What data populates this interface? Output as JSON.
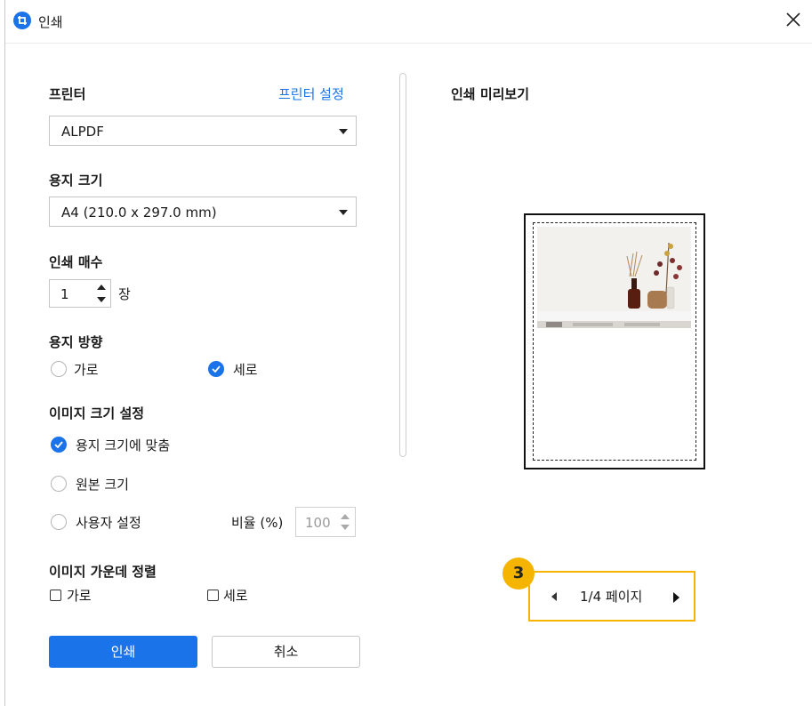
{
  "window": {
    "title": "인쇄",
    "close_icon": "close-icon"
  },
  "printer": {
    "label": "프린터",
    "settings_link": "프린터 설정",
    "selected": "ALPDF"
  },
  "paper_size": {
    "label": "용지 크기",
    "selected": "A4 (210.0 x 297.0 mm)"
  },
  "copies": {
    "label": "인쇄 매수",
    "value": "1",
    "unit": "장"
  },
  "orientation": {
    "label": "용지 방향",
    "options": [
      {
        "label": "가로",
        "selected": false
      },
      {
        "label": "세로",
        "selected": true
      }
    ]
  },
  "image_size": {
    "label": "이미지 크기 설정",
    "options": [
      {
        "label": "용지 크기에 맞춤",
        "selected": true
      },
      {
        "label": "원본 크기",
        "selected": false
      },
      {
        "label": "사용자 설정",
        "selected": false
      }
    ],
    "ratio_label": "비율 (%)",
    "ratio_value": "100"
  },
  "center": {
    "label": "이미지 가운데 정렬",
    "options": [
      {
        "label": "가로",
        "checked": false
      },
      {
        "label": "세로",
        "checked": false
      }
    ]
  },
  "buttons": {
    "print": "인쇄",
    "cancel": "취소"
  },
  "preview": {
    "label": "인쇄 미리보기",
    "page_indicator": "1/4 페이지"
  },
  "annotation": {
    "badge": "3",
    "color": "#f4b400"
  },
  "colors": {
    "accent": "#1a73e8",
    "highlight": "#f4b400"
  }
}
